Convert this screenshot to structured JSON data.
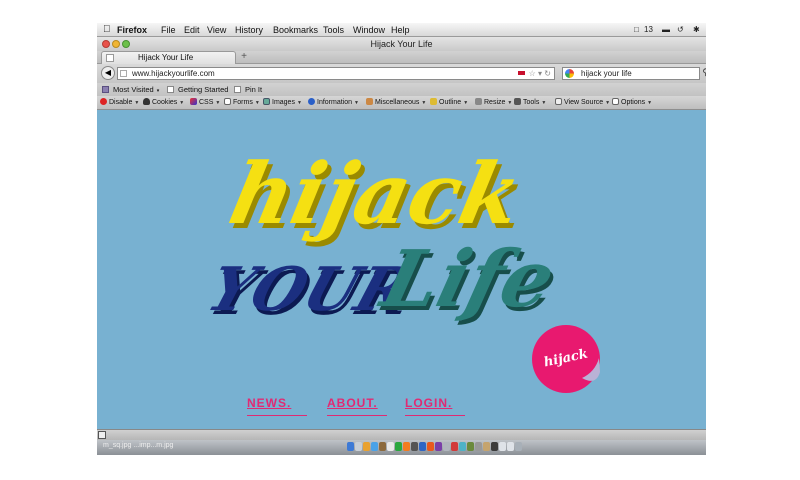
{
  "menubar": {
    "app": "Firefox",
    "items": [
      "File",
      "Edit",
      "View",
      "History",
      "Bookmarks",
      "Tools",
      "Window",
      "Help"
    ],
    "battery": "13"
  },
  "window": {
    "title": "Hijack Your Life"
  },
  "tab": {
    "label": "Hijack Your Life",
    "new_tab": "+"
  },
  "navbar": {
    "url": "www.hijackyourlife.com",
    "search_value": "hijack your life"
  },
  "bookmarks": [
    "Most Visited",
    "Getting Started",
    "Pin It"
  ],
  "devbar": [
    "Disable",
    "Cookies",
    "CSS",
    "Forms",
    "Images",
    "Information",
    "Miscellaneous",
    "Outline",
    "Resize",
    "Tools",
    "View Source",
    "Options"
  ],
  "site": {
    "logo_word1": "hijack",
    "logo_word2": "YOUR",
    "logo_word3": "Life",
    "sticker": "hijack",
    "nav": [
      "NEWS.",
      "ABOUT.",
      "LOGIN."
    ],
    "colors": {
      "background": "#78b1d1",
      "yellow": "#f5e012",
      "navy": "#1b2f80",
      "teal": "#2a7f7a",
      "pink": "#e02a73"
    }
  },
  "dock": {
    "file_label": "...imp...m.jpg",
    "file_sub": "m_sq.jpg"
  }
}
